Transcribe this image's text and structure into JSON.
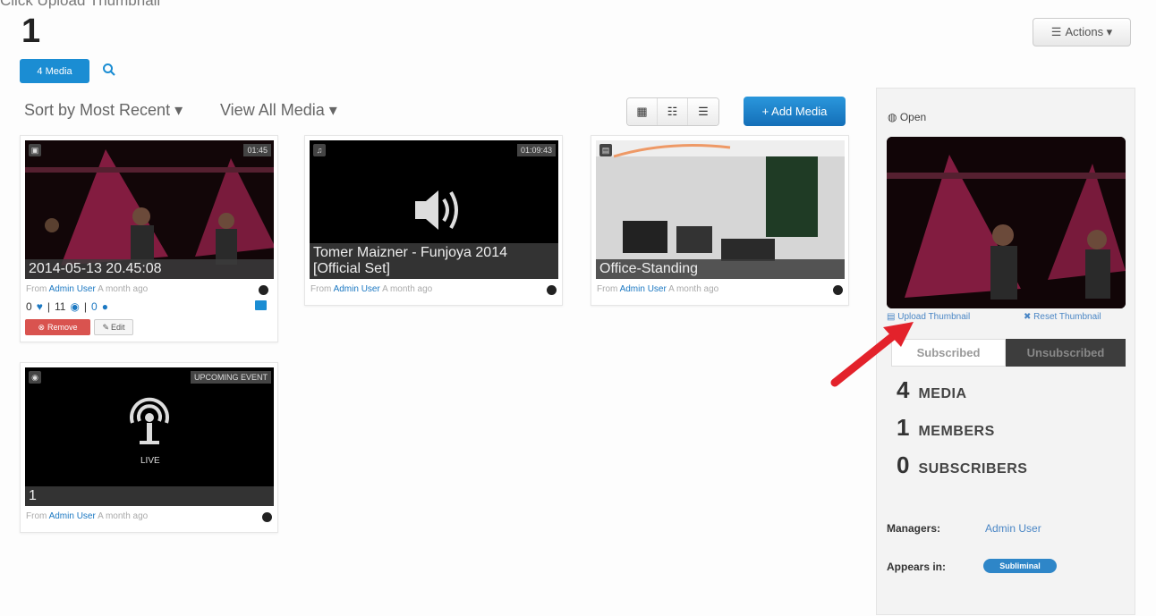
{
  "caption": "Click Upload Thumbnail",
  "page_title": "1",
  "actions_label": "Actions ▾",
  "media_tab": "4 Media",
  "sort_label": "Sort by Most Recent ▾",
  "view_all_label": "View All Media ▾",
  "add_media_label": "+ Add Media",
  "cards": [
    {
      "title": "2014-05-13 20.45:08",
      "duration": "01:45",
      "type_icon": "video-icon",
      "from": "From",
      "user": "Admin User",
      "time": "A month ago",
      "stats": {
        "likes": "0",
        "views": "11",
        "comments": "0"
      },
      "remove": "Remove",
      "edit": "Edit"
    },
    {
      "title": "Tomer Maizner - Funjoya 2014 [Official Set]",
      "duration": "01:09:43",
      "type_icon": "audio-icon",
      "from": "From",
      "user": "Admin User",
      "time": "A month ago"
    },
    {
      "title": "Office-Standing",
      "type_icon": "image-icon",
      "from": "From",
      "user": "Admin User",
      "time": "A month ago"
    },
    {
      "title": "1",
      "badge": "UPCOMING EVENT",
      "live": "LIVE",
      "type_icon": "live-icon",
      "from": "From",
      "user": "Admin User",
      "time": "A month ago"
    }
  ],
  "sidebar": {
    "open_label": "Open",
    "upload_thumbnail": "Upload Thumbnail",
    "reset_thumbnail": "Reset Thumbnail",
    "subscribed": "Subscribed",
    "unsubscribed": "Unsubscribed",
    "stats": [
      {
        "num": "4",
        "label": "MEDIA"
      },
      {
        "num": "1",
        "label": "MEMBERS"
      },
      {
        "num": "0",
        "label": "SUBSCRIBERS"
      }
    ],
    "managers_label": "Managers:",
    "managers_value": "Admin User",
    "appears_label": "Appears in:",
    "appears_value": "Subliminal"
  },
  "colors": {
    "primary": "#1b8dd3",
    "danger": "#d9534f",
    "annotation_arrow": "#e3222b"
  }
}
